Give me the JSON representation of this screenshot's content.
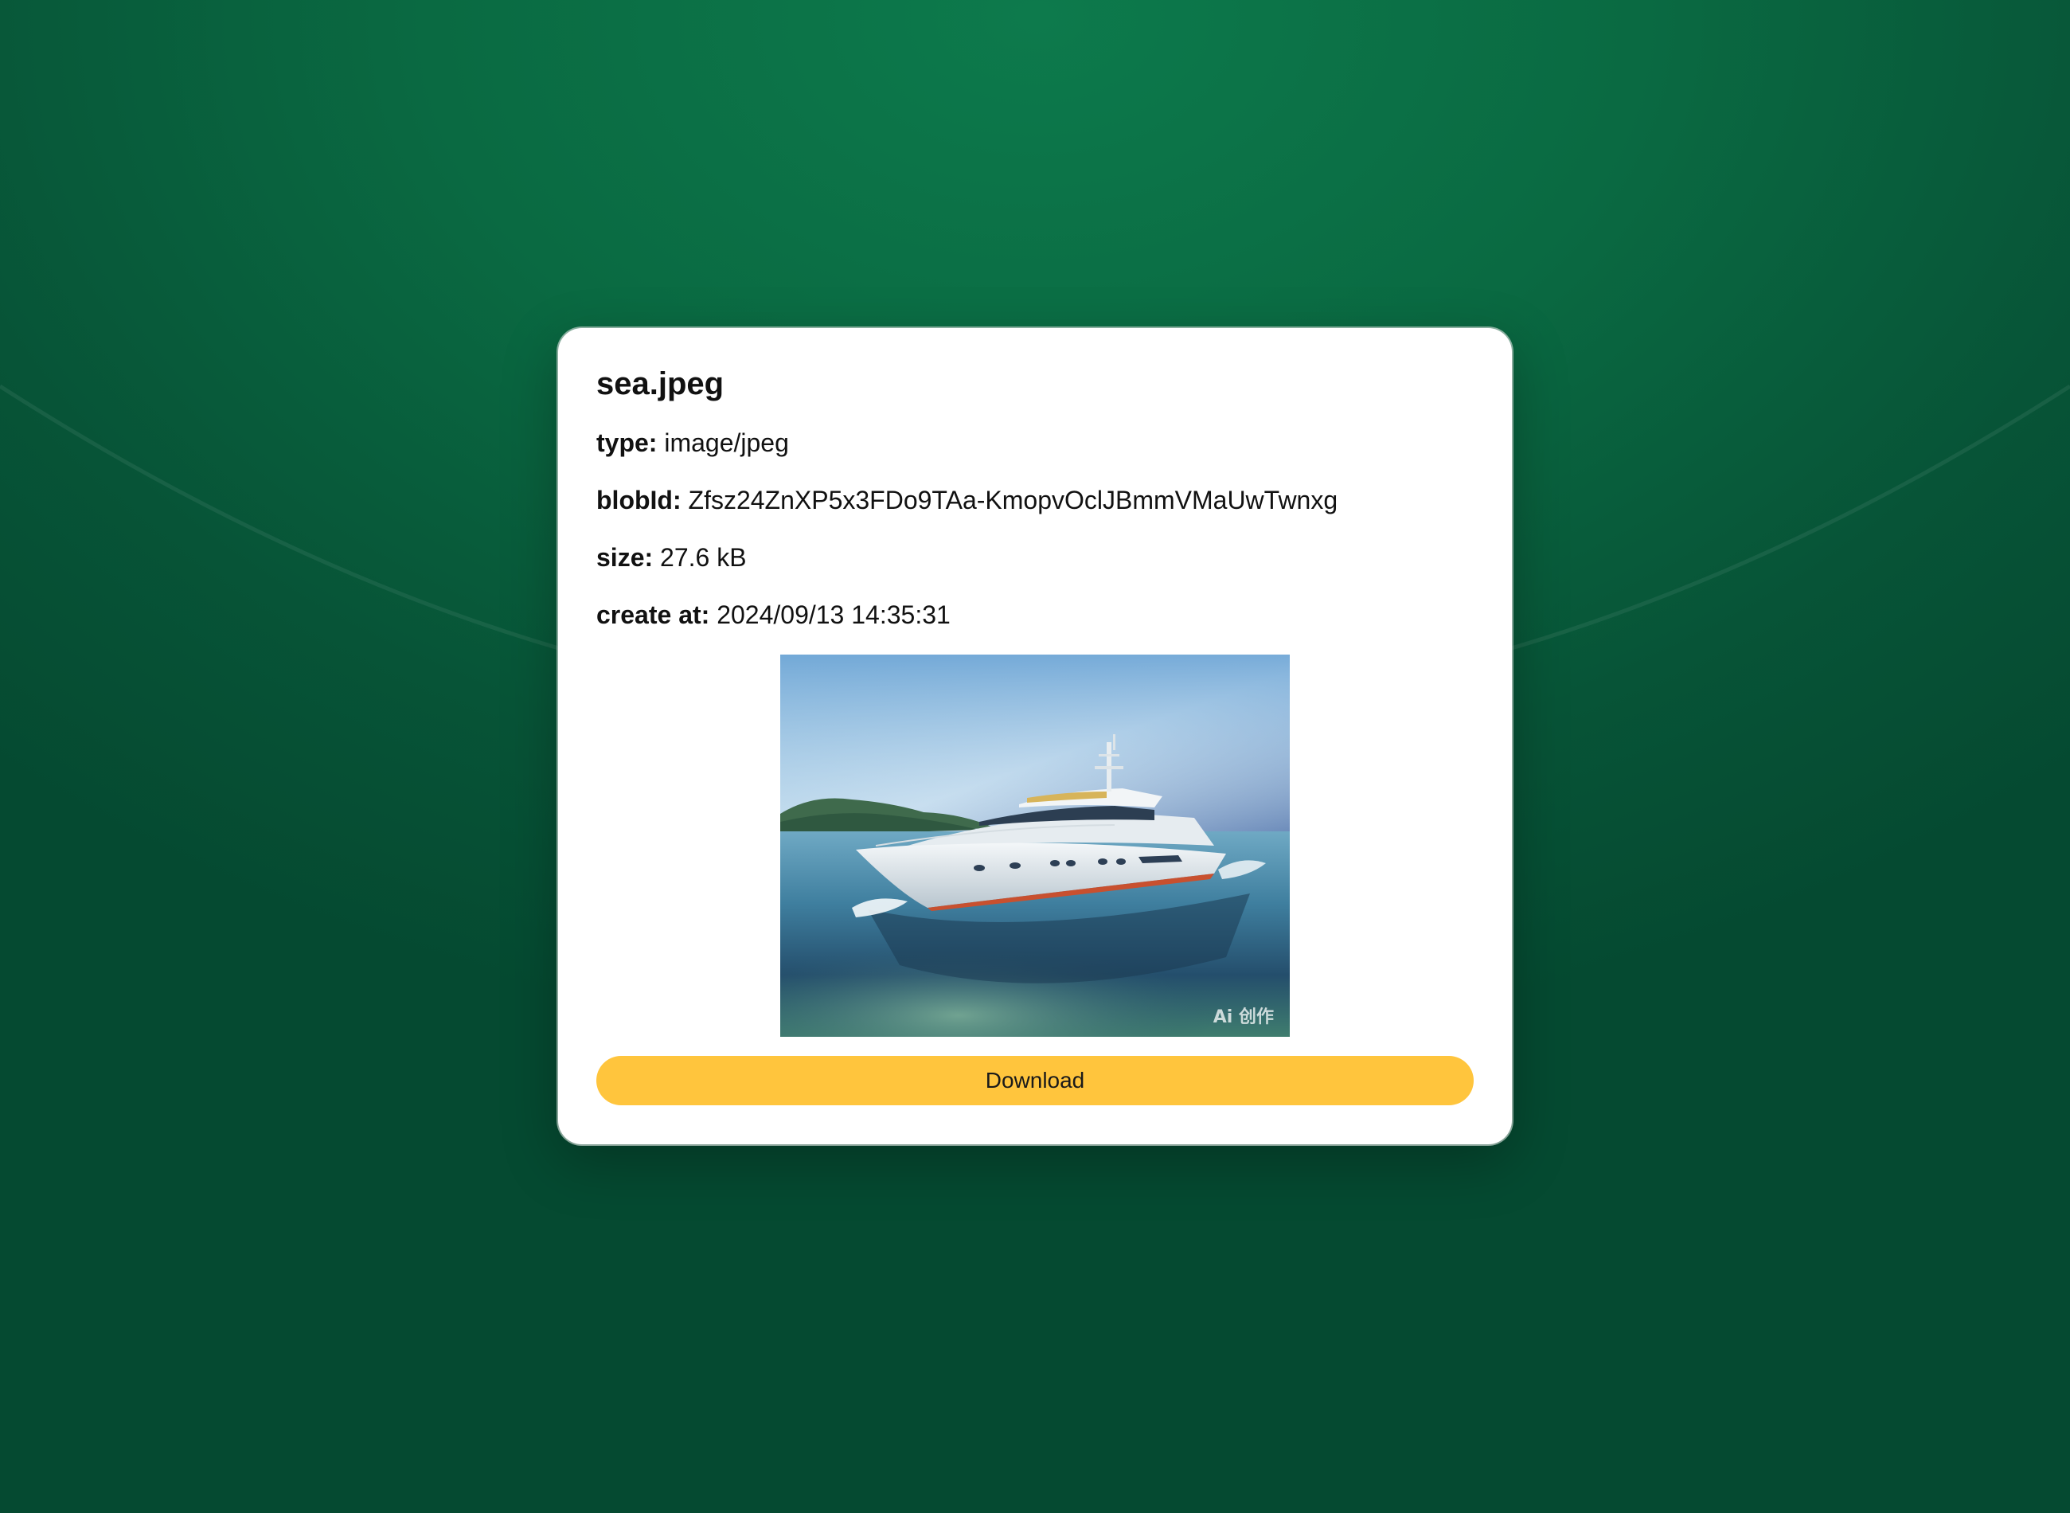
{
  "file": {
    "name": "sea.jpeg",
    "fields": [
      {
        "key": "type:",
        "value": "image/jpeg"
      },
      {
        "key": "blobId:",
        "value": "Zfsz24ZnXP5x3FDo9TAa-KmopvOclJBmmVMaUwTwnxg"
      },
      {
        "key": "size:",
        "value": "27.6 kB"
      },
      {
        "key": "create at:",
        "value": "2024/09/13 14:35:31"
      }
    ],
    "preview": {
      "subject": "yacht-on-sea",
      "watermark": "Ai 创作"
    }
  },
  "actions": {
    "download_label": "Download"
  },
  "colors": {
    "background": "#0a6a42",
    "card": "#ffffff",
    "button": "#ffc53d"
  }
}
